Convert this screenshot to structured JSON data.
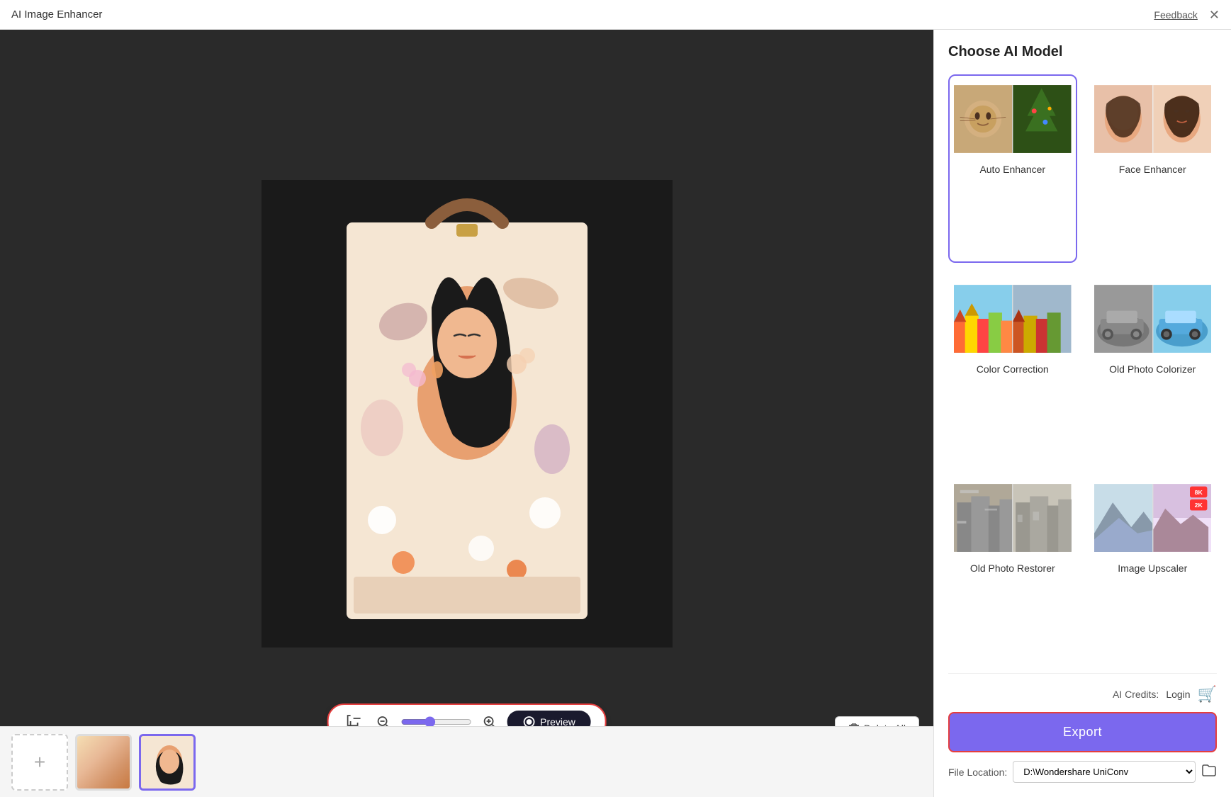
{
  "titleBar": {
    "title": "AI Image Enhancer",
    "feedback": "Feedback",
    "close": "✕"
  },
  "toolbar": {
    "cropIcon": "⬚",
    "zoomOutIcon": "−",
    "zoomInIcon": "+",
    "previewLabel": "Preview",
    "eyeIcon": "👁",
    "deleteAllLabel": "Delete All",
    "trashIcon": "🗑"
  },
  "panel": {
    "title": "Choose AI Model",
    "models": [
      {
        "id": "auto-enhancer",
        "label": "Auto Enhancer",
        "selected": true
      },
      {
        "id": "face-enhancer",
        "label": "Face Enhancer",
        "selected": false
      },
      {
        "id": "color-correction",
        "label": "Color Correction",
        "selected": false
      },
      {
        "id": "old-photo-colorizer",
        "label": "Old Photo Colorizer",
        "selected": false
      },
      {
        "id": "old-photo-restorer",
        "label": "Old Photo Restorer",
        "selected": false
      },
      {
        "id": "image-upscaler",
        "label": "Image Upscaler",
        "selected": false
      }
    ]
  },
  "bottomPanel": {
    "creditsLabel": "AI Credits:",
    "loginLabel": "Login",
    "exportLabel": "Export",
    "fileLocationLabel": "File Location:",
    "fileLocationValue": "D:\\Wondershare UniConv",
    "folderIcon": "📁"
  },
  "thumbnails": {
    "addLabel": "+"
  }
}
